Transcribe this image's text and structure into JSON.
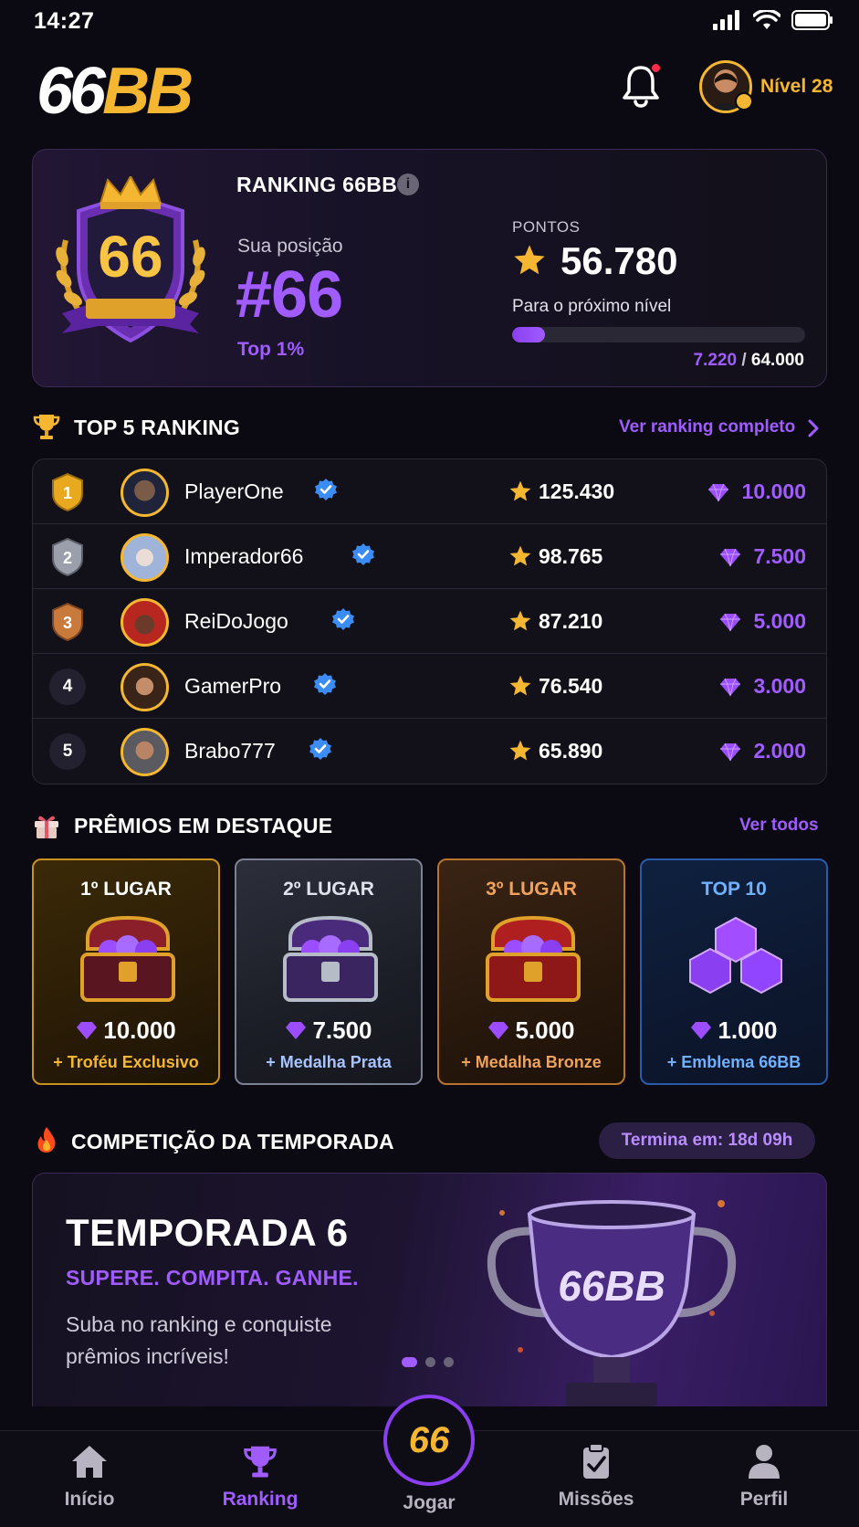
{
  "status_bar": {
    "time": "14:27"
  },
  "header": {
    "logo_part1": "66",
    "logo_part2": "BB",
    "level_label": "Nível 28"
  },
  "ranking_card": {
    "title": "RANKING 66BB",
    "badge_number": "66",
    "position_label": "Sua posição",
    "position_value": "#66",
    "top_percent": "Top 1%",
    "points_label": "PONTOS",
    "points_value": "56.780",
    "next_level_label": "Para o próximo nível",
    "progress_current": "7.220",
    "progress_separator": "/",
    "progress_target": "64.000",
    "progress_fraction": 0.1128
  },
  "top5": {
    "title": "TOP 5 RANKING",
    "link": "Ver ranking completo",
    "rows": [
      {
        "rank": "1",
        "name": "PlayerOne",
        "points": "125.430",
        "gems": "10.000"
      },
      {
        "rank": "2",
        "name": "Imperador66",
        "points": "98.765",
        "gems": "7.500"
      },
      {
        "rank": "3",
        "name": "ReiDoJogo",
        "points": "87.210",
        "gems": "5.000"
      },
      {
        "rank": "4",
        "name": "GamerPro",
        "points": "76.540",
        "gems": "3.000"
      },
      {
        "rank": "5",
        "name": "Brabo777",
        "points": "65.890",
        "gems": "2.000"
      }
    ]
  },
  "prizes": {
    "title": "PRÊMIOS EM DESTAQUE",
    "link": "Ver todos",
    "items": [
      {
        "title": "1º LUGAR",
        "amount": "10.000",
        "bonus": "+ Troféu Exclusivo"
      },
      {
        "title": "2º LUGAR",
        "amount": "7.500",
        "bonus": "+ Medalha Prata"
      },
      {
        "title": "3º LUGAR",
        "amount": "5.000",
        "bonus": "+ Medalha Bronze"
      },
      {
        "title": "TOP 10",
        "amount": "1.000",
        "bonus": "+ Emblema 66BB"
      }
    ]
  },
  "season": {
    "section_title": "COMPETIÇÃO DA TEMPORADA",
    "timer": "Termina em: 18d 09h",
    "title": "TEMPORADA 6",
    "tagline": "SUPERE. COMPITA. GANHE.",
    "description": "Suba no ranking e conquiste prêmios incríveis!",
    "trophy_text": "66BB"
  },
  "bottom_nav": {
    "items": [
      {
        "label": "Início"
      },
      {
        "label": "Ranking"
      },
      {
        "label": "Jogar",
        "badge": "66"
      },
      {
        "label": "Missões"
      },
      {
        "label": "Perfil"
      }
    ]
  },
  "colors": {
    "accent_purple": "#a05cff",
    "gold": "#f5b731",
    "background": "#0b0a12"
  }
}
